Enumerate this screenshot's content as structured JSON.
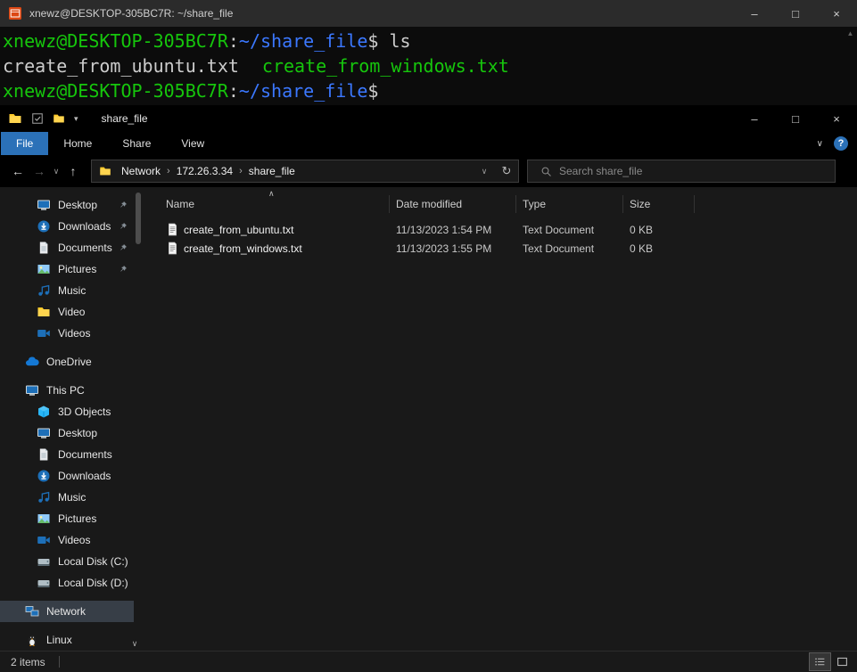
{
  "colors": {
    "terminal_green": "#16c60c",
    "terminal_blue": "#3b78ff",
    "terminal_bg": "#0c0c0c",
    "explorer_bg": "#191919",
    "file_tab_blue": "#2b71b8",
    "sidebar_selected": "#373e47"
  },
  "terminal": {
    "title": "xnewz@DESKTOP-305BC7R: ~/share_file",
    "user_host": "xnewz@DESKTOP-305BC7R",
    "colon": ":",
    "cwd": "~/share_file",
    "prompt_symbol": "$",
    "command": "ls",
    "output_file_1": "create_from_ubuntu.txt",
    "output_file_2": "create_from_windows.txt"
  },
  "explorer": {
    "title": "share_file",
    "tabs": {
      "file": "File",
      "home": "Home",
      "share": "Share",
      "view": "View"
    },
    "nav": {
      "crumb_network": "Network",
      "crumb_host": "172.26.3.34",
      "crumb_folder": "share_file",
      "search_placeholder": "Search share_file"
    },
    "columns": {
      "name": "Name",
      "modified": "Date modified",
      "type": "Type",
      "size": "Size"
    },
    "files": [
      {
        "name": "create_from_ubuntu.txt",
        "modified": "11/13/2023 1:54 PM",
        "type": "Text Document",
        "size": "0 KB"
      },
      {
        "name": "create_from_windows.txt",
        "modified": "11/13/2023 1:55 PM",
        "type": "Text Document",
        "size": "0 KB"
      }
    ],
    "sidebar": {
      "items": [
        {
          "label": "Desktop",
          "icon": "monitor",
          "pinned": true
        },
        {
          "label": "Downloads",
          "icon": "download-circle",
          "pinned": true
        },
        {
          "label": "Documents",
          "icon": "document",
          "pinned": true
        },
        {
          "label": "Pictures",
          "icon": "picture",
          "pinned": true
        },
        {
          "label": "Music",
          "icon": "music-note",
          "pinned": false
        },
        {
          "label": "Video",
          "icon": "folder",
          "pinned": false
        },
        {
          "label": "Videos",
          "icon": "video-camera",
          "pinned": false
        },
        {
          "label": "OneDrive",
          "icon": "cloud",
          "pinned": false
        },
        {
          "label": "This PC",
          "icon": "computer",
          "pinned": false
        },
        {
          "label": "3D Objects",
          "icon": "cube",
          "pinned": false
        },
        {
          "label": "Desktop",
          "icon": "monitor",
          "pinned": false
        },
        {
          "label": "Documents",
          "icon": "document",
          "pinned": false
        },
        {
          "label": "Downloads",
          "icon": "download-circle",
          "pinned": false
        },
        {
          "label": "Music",
          "icon": "music-note",
          "pinned": false
        },
        {
          "label": "Pictures",
          "icon": "picture",
          "pinned": false
        },
        {
          "label": "Videos",
          "icon": "video-camera",
          "pinned": false
        },
        {
          "label": "Local Disk (C:)",
          "icon": "hard-drive",
          "pinned": false
        },
        {
          "label": "Local Disk (D:)",
          "icon": "hard-drive",
          "pinned": false
        },
        {
          "label": "Network",
          "icon": "network",
          "pinned": false,
          "selected": true
        },
        {
          "label": "Linux",
          "icon": "penguin",
          "pinned": false
        }
      ]
    },
    "statusbar": {
      "count": "2 items"
    }
  },
  "icons": {
    "minimize": "–",
    "maximize": "□",
    "close": "×",
    "back": "←",
    "forward": "→",
    "up": "↑",
    "refresh": "↻",
    "chevron_down": "∨",
    "sort_asc": "∧",
    "crumb_sep": "›",
    "scroll_up": "▲",
    "qat_dropdown": "▾",
    "help": "?"
  }
}
